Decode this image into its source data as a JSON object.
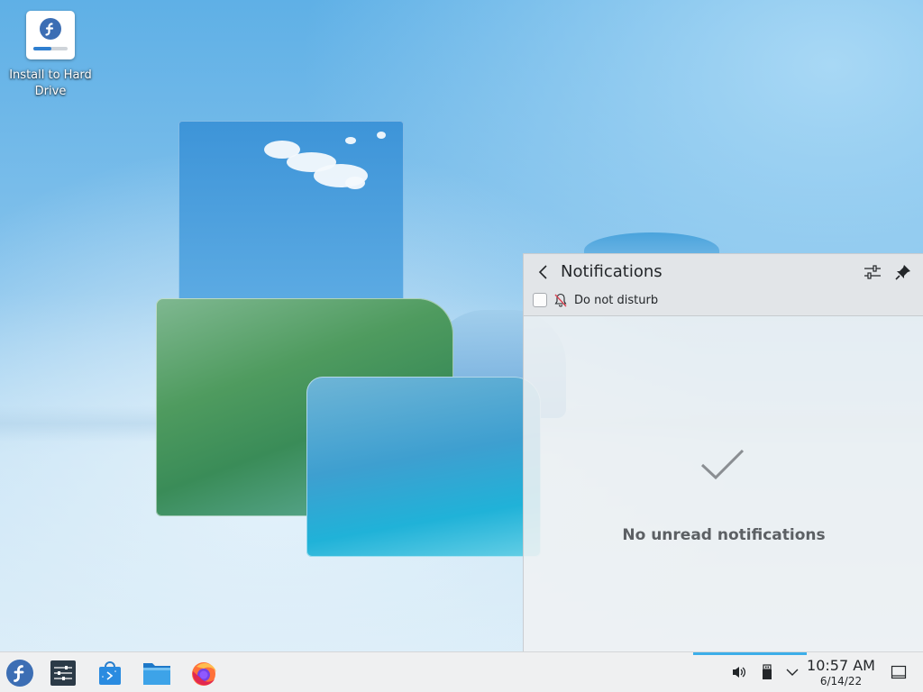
{
  "desktop": {
    "icons": [
      {
        "label_line1": "Install to Hard",
        "label_line2": "Drive",
        "icon": "fedora-install-icon"
      }
    ]
  },
  "notifications_panel": {
    "title": "Notifications",
    "dnd_label": "Do not disturb",
    "dnd_checked": false,
    "empty_text": "No unread notifications",
    "accent_color": "#3daee9"
  },
  "taskbar": {
    "apps": [
      {
        "name": "application-launcher",
        "icon": "fedora-logo-icon"
      },
      {
        "name": "system-settings",
        "icon": "settings-sliders-icon"
      },
      {
        "name": "discover",
        "icon": "software-store-icon"
      },
      {
        "name": "dolphin",
        "icon": "file-manager-folder-icon"
      },
      {
        "name": "firefox",
        "icon": "firefox-icon"
      }
    ],
    "tray": [
      {
        "icon": "volume-icon"
      },
      {
        "icon": "removable-device-icon"
      },
      {
        "icon": "chevron-down-icon"
      }
    ],
    "clock": {
      "time": "10:57 AM",
      "date": "6/14/22"
    }
  }
}
